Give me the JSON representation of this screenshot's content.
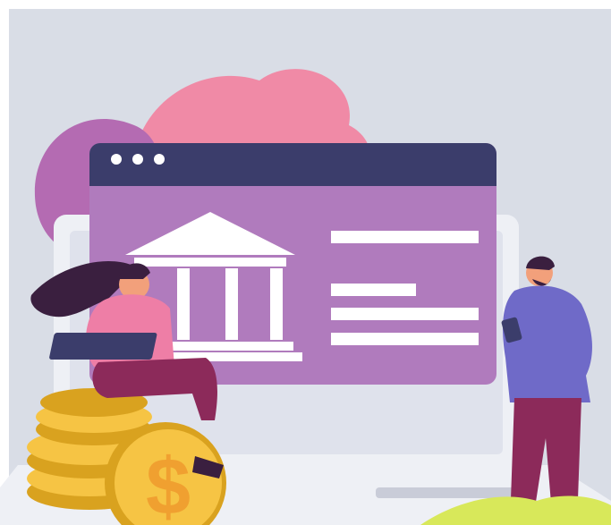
{
  "scene": {
    "name": "online-banking-illustration",
    "colors": {
      "background": "#d9dde6",
      "blob_pink": "#f08aa6",
      "blob_purple": "#b46bb2",
      "browser_titlebar": "#3b3d6b",
      "browser_body": "#b07bbd",
      "bank_white": "#ffffff",
      "coin_gold": "#f6c444",
      "coin_dark": "#d9a21f",
      "woman_top": "#ee7ea6",
      "woman_pants": "#8c2a5a",
      "man_shirt": "#6f6ac8",
      "man_pants": "#8c2a5a",
      "skin": "#f2a07b",
      "hair_dark": "#3a1f3f",
      "laptop_frame": "#eef0f5",
      "ground_green": "#d8e85a"
    },
    "icons": {
      "bank": "bank-building-icon",
      "dots": "window-controls-icon",
      "currency": "dollar-sign-icon"
    }
  }
}
